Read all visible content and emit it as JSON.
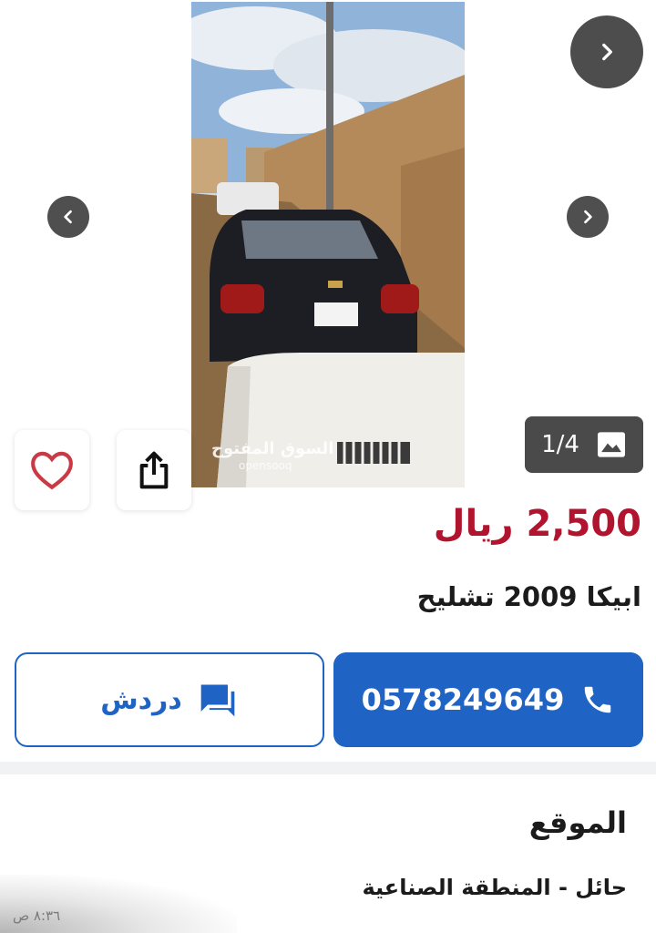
{
  "gallery": {
    "counter": "1/4",
    "watermark_ar": "السوق المفتوح",
    "watermark_en": "opensooq"
  },
  "listing": {
    "price": "2,500 ريال",
    "title": "ابيكا 2009 تشليح"
  },
  "actions": {
    "phone": "0578249649",
    "chat_label": "دردش"
  },
  "location": {
    "heading": "الموقع",
    "value": "حائل - المنطقة الصناعية"
  },
  "status_bar": {
    "time": "٨:٣٦ ص"
  },
  "colors": {
    "price": "#b0142e",
    "primary": "#1f63c4"
  },
  "icons": [
    "chevron-right-icon",
    "chevron-left-icon",
    "image-icon",
    "heart-icon",
    "share-icon",
    "phone-icon",
    "chat-icon"
  ]
}
